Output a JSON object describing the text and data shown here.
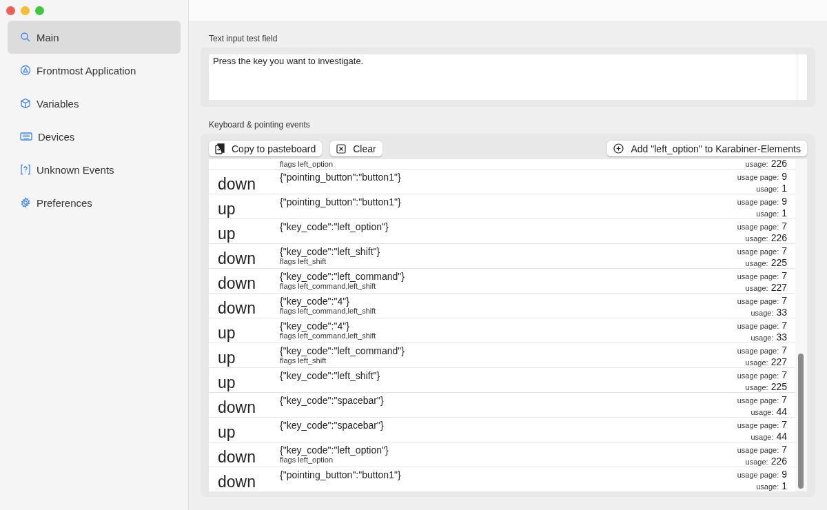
{
  "sidebar": {
    "items": [
      {
        "label": "Main",
        "kind": "search",
        "selected": true
      },
      {
        "label": "Frontmost Application",
        "kind": "app",
        "selected": false
      },
      {
        "label": "Variables",
        "kind": "cube",
        "selected": false
      },
      {
        "label": "Devices",
        "kind": "keyboard",
        "selected": false
      },
      {
        "label": "Unknown Events",
        "kind": "question",
        "selected": false
      },
      {
        "label": "Preferences",
        "kind": "gear",
        "selected": false
      }
    ]
  },
  "text_input": {
    "title": "Text input test field",
    "value": "Press the key you want to investigate."
  },
  "events": {
    "title": "Keyboard & pointing events",
    "buttons": [
      {
        "label": "Copy to pasteboard",
        "kind": "copy"
      },
      {
        "label": "Clear",
        "kind": "clear"
      },
      {
        "label": "Add \"left_option\" to Karabiner-Elements",
        "kind": "add"
      }
    ],
    "rows": [
      {
        "flags": "flags left_option",
        "usage_label": "usage:",
        "usage": "226"
      },
      {
        "event": "down",
        "detail": "{\"pointing_button\":\"button1\"}",
        "usage_page_label": "usage page:",
        "usage_page": "9",
        "usage_label": "usage:",
        "usage": "1"
      },
      {
        "event": "up",
        "detail": "{\"pointing_button\":\"button1\"}",
        "usage_page_label": "usage page:",
        "usage_page": "9",
        "usage_label": "usage:",
        "usage": "1"
      },
      {
        "event": "up",
        "detail": "{\"key_code\":\"left_option\"}",
        "usage_page_label": "usage page:",
        "usage_page": "7",
        "usage_label": "usage:",
        "usage": "226"
      },
      {
        "event": "down",
        "detail": "{\"key_code\":\"left_shift\"}",
        "flags": "flags left_shift",
        "usage_page_label": "usage page:",
        "usage_page": "7",
        "usage_label": "usage:",
        "usage": "225"
      },
      {
        "event": "down",
        "detail": "{\"key_code\":\"left_command\"}",
        "flags": "flags left_command,left_shift",
        "usage_page_label": "usage page:",
        "usage_page": "7",
        "usage_label": "usage:",
        "usage": "227"
      },
      {
        "event": "down",
        "detail": "{\"key_code\":\"4\"}",
        "flags": "flags left_command,left_shift",
        "usage_page_label": "usage page:",
        "usage_page": "7",
        "usage_label": "usage:",
        "usage": "33"
      },
      {
        "event": "up",
        "detail": "{\"key_code\":\"4\"}",
        "flags": "flags left_command,left_shift",
        "usage_page_label": "usage page:",
        "usage_page": "7",
        "usage_label": "usage:",
        "usage": "33"
      },
      {
        "event": "up",
        "detail": "{\"key_code\":\"left_command\"}",
        "flags": "flags left_shift",
        "usage_page_label": "usage page:",
        "usage_page": "7",
        "usage_label": "usage:",
        "usage": "227"
      },
      {
        "event": "up",
        "detail": "{\"key_code\":\"left_shift\"}",
        "usage_page_label": "usage page:",
        "usage_page": "7",
        "usage_label": "usage:",
        "usage": "225"
      },
      {
        "event": "down",
        "detail": "{\"key_code\":\"spacebar\"}",
        "usage_page_label": "usage page:",
        "usage_page": "7",
        "usage_label": "usage:",
        "usage": "44"
      },
      {
        "event": "up",
        "detail": "{\"key_code\":\"spacebar\"}",
        "usage_page_label": "usage page:",
        "usage_page": "7",
        "usage_label": "usage:",
        "usage": "44"
      },
      {
        "event": "down",
        "detail": "{\"key_code\":\"left_option\"}",
        "flags": "flags left_option",
        "usage_page_label": "usage page:",
        "usage_page": "7",
        "usage_label": "usage:",
        "usage": "226"
      },
      {
        "event": "down",
        "detail": "{\"pointing_button\":\"button1\"}",
        "usage_page_label": "usage page:",
        "usage_page": "9",
        "usage_label": "usage:",
        "usage": "1"
      }
    ]
  }
}
